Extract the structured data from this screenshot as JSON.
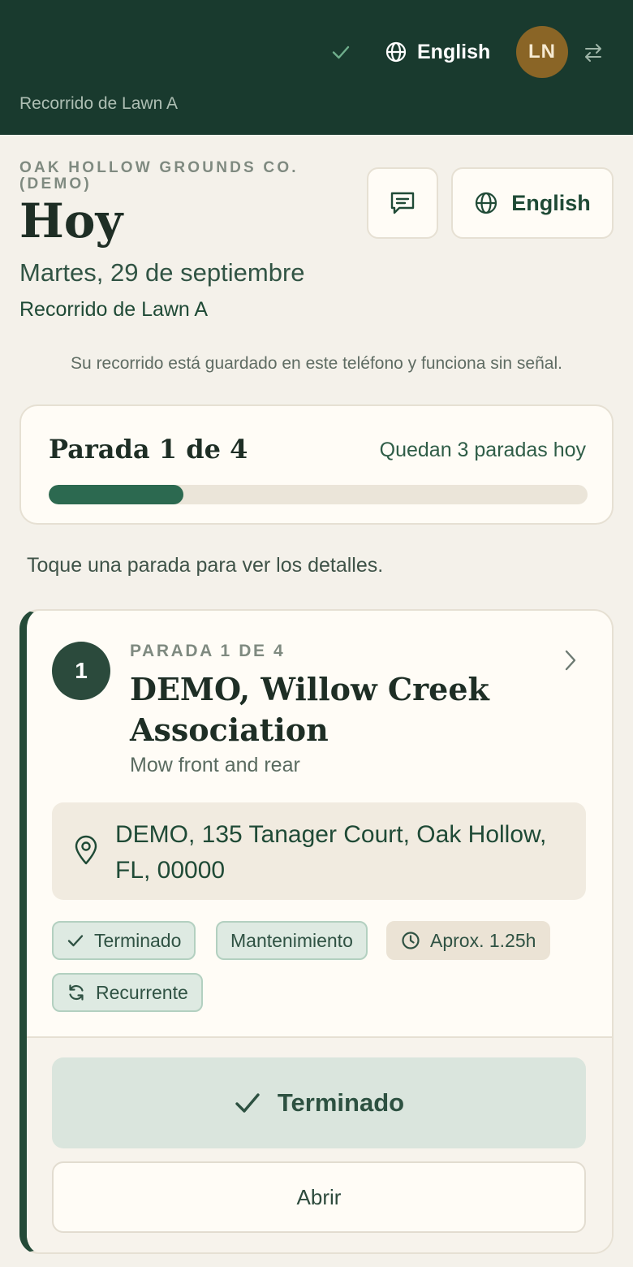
{
  "topbar": {
    "language_label": "English",
    "avatar_initials": "LN",
    "route_label": "Recorrido de Lawn A"
  },
  "header": {
    "company": "OAK HOLLOW GROUNDS CO. (DEMO)",
    "title": "Hoy",
    "date": "Martes, 29 de septiembre",
    "route": "Recorrido de Lawn A",
    "language_button": "English"
  },
  "offline_note": "Su recorrido está guardado en este teléfono y funciona sin señal.",
  "progress": {
    "title": "Parada 1 de 4",
    "remaining": "Quedan 3 paradas hoy",
    "fraction": 0.25
  },
  "tap_hint": "Toque una parada para ver los detalles.",
  "stop": {
    "number": "1",
    "kicker": "PARADA 1 DE 4",
    "title": "DEMO, Willow Creek Association",
    "subtitle": "Mow front and rear",
    "address": "DEMO, 135 Tanager Court, Oak Hollow, FL, 00000",
    "chips": {
      "status": "Terminado",
      "type": "Mantenimiento",
      "duration": "Aprox. 1.25h",
      "recurring": "Recurrente"
    },
    "done_button": "Terminado",
    "open_button": "Abrir"
  },
  "colors": {
    "topbar_bg": "#193a2e",
    "accent_green": "#2c6950",
    "avatar_bg": "#8a6526",
    "page_bg": "#f4f1ea"
  }
}
